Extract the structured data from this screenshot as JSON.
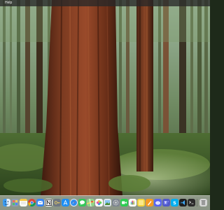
{
  "menubar": {
    "items": [
      "",
      "Help"
    ]
  },
  "colors": {
    "menubar_bg": "#282828",
    "dock_bg": "#e1e1e1",
    "bark": "#8a3f22",
    "forest": "#2f4a22"
  },
  "dock": {
    "apps": [
      "finder-icon",
      "launchpad-icon",
      "notes-icon",
      "chrome-icon",
      "mail-icon",
      "notion-icon",
      "keychain-icon",
      "app-store-icon",
      "safari-icon",
      "messages-icon",
      "maps-icon",
      "photos-icon",
      "preview-icon",
      "system-settings-icon",
      "facetime-icon",
      "slack-icon",
      "stickies-icon",
      "pages-icon",
      "discord-icon",
      "teams-icon",
      "skype-icon",
      "vscode-icon",
      "terminal-icon",
      "finder-folder-icon",
      "trash-icon"
    ]
  }
}
